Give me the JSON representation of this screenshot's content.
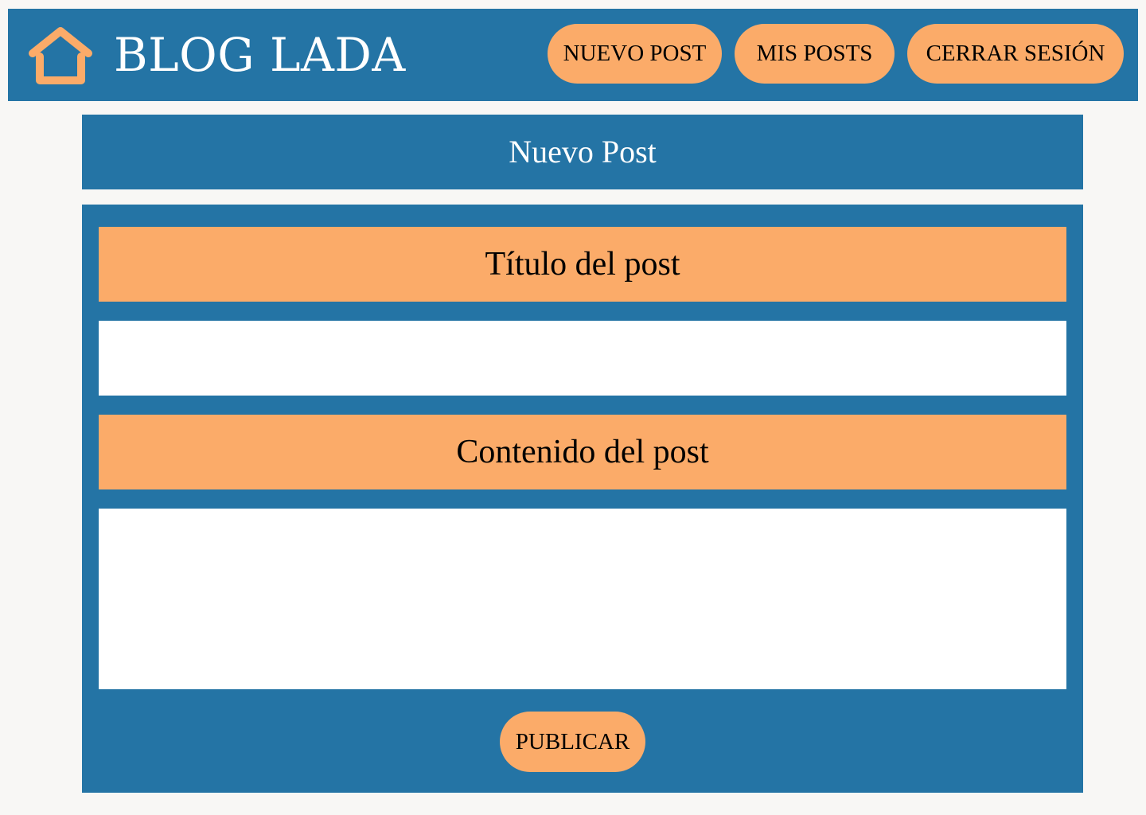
{
  "header": {
    "brand": "BLOG LADA",
    "home_icon": "home-icon",
    "nav": {
      "new_post": "NUEVO POST",
      "my_posts": "MIS POSTS",
      "logout": "CERRAR SESIÓN"
    }
  },
  "page": {
    "title": "Nuevo Post"
  },
  "form": {
    "title_label": "Título del post",
    "title_value": "",
    "content_label": "Contenido del post",
    "content_value": "",
    "publish_label": "PUBLICAR"
  },
  "colors": {
    "primary": "#2474a5",
    "accent": "#fbab69",
    "background": "#f8f7f5",
    "field": "#ffffff"
  }
}
